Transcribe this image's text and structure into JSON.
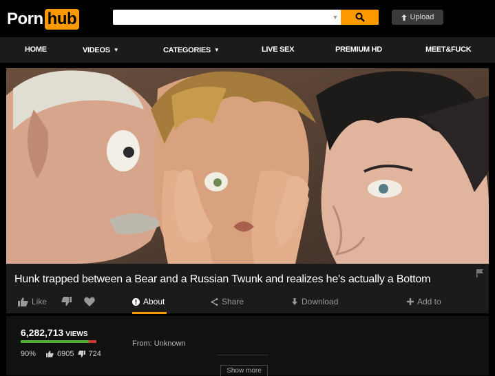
{
  "header": {
    "logo_left": "Porn",
    "logo_right": "hub",
    "search_value": "",
    "upload_label": "Upload"
  },
  "nav": {
    "items": [
      {
        "label": "HOME",
        "dropdown": false
      },
      {
        "label": "VIDEOS",
        "dropdown": true
      },
      {
        "label": "CATEGORIES",
        "dropdown": true
      },
      {
        "label": "LIVE SEX",
        "dropdown": false
      },
      {
        "label": "PREMIUM HD",
        "dropdown": false
      },
      {
        "label": "MEET&FUCK",
        "dropdown": false
      }
    ]
  },
  "video": {
    "title": "Hunk trapped between a Bear and a Russian Twunk and realizes he's actually a Bottom"
  },
  "actions": {
    "like": "Like",
    "about": "About",
    "share": "Share",
    "download": "Download",
    "add_to": "Add to"
  },
  "stats": {
    "views_count": "6,282,713",
    "views_label": "VIEWS",
    "rating_percent": 90,
    "rating_text": "90%",
    "likes": "6905",
    "dislikes": "724",
    "from_label": "From:",
    "from_value": "Unknown",
    "show_more": "Show more"
  },
  "colors": {
    "accent": "#ff9900",
    "nav_bg": "#1b1b1b",
    "like_bar": "#4caf32",
    "dislike_bar": "#d4392c"
  }
}
